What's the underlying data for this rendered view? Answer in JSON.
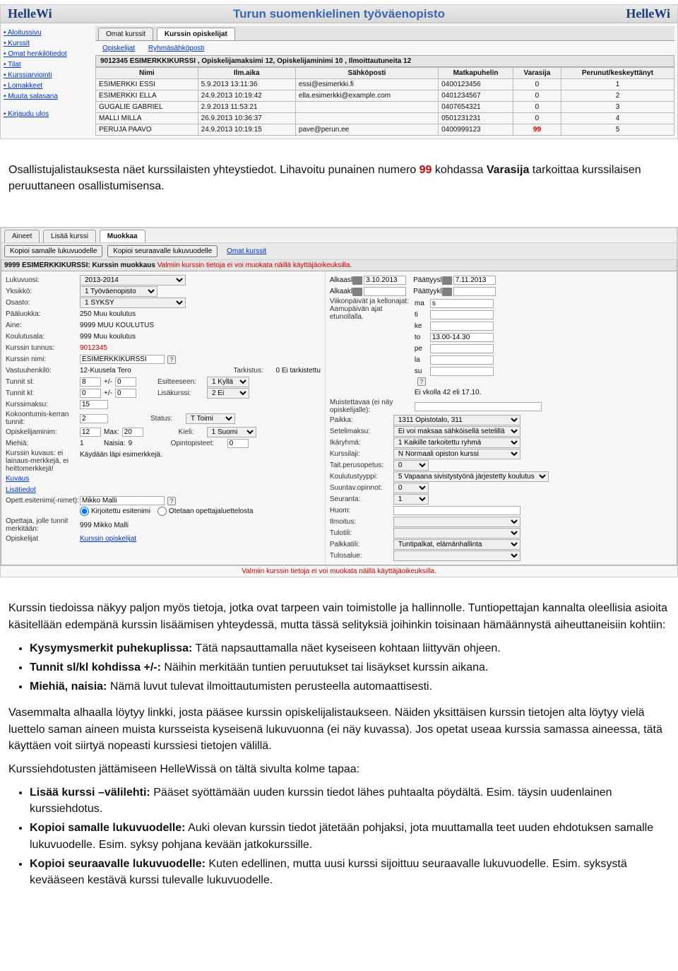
{
  "ss1": {
    "logoLeft": "HelleWi",
    "logoRight": "HelleWi",
    "title": "Turun suomenkielinen työväenopisto",
    "nav": [
      "Aloitussivu",
      "Kurssit",
      "Omat henkilötiedot",
      "Tilat",
      "Kurssiarviointi",
      "Lomakkeet",
      "Muuta salasana"
    ],
    "logout": "Kirjaudu ulos",
    "tabsTop": {
      "t1": "Omat kurssit",
      "t2": "Kurssin opiskelijat"
    },
    "subtabs": {
      "a": "Opiskelijat",
      "b": "Ryhmäsähköposti"
    },
    "tableTitle": "9012345 ESIMERKKIKURSSI , Opiskelijamaksimi 12, Opiskelijaminimi 10 , Ilmoittautuneita 12",
    "cols": [
      "Nimi",
      "Ilm.aika",
      "Sähköposti",
      "Matkapuhelin",
      "Varasija",
      "Perunut/keskeyttänyt"
    ],
    "rows": [
      {
        "n": "ESIMERKKI ESSI",
        "a": "5.9.2013 13:11:36",
        "e": "essi@esimerkki.fi",
        "m": "0400123456",
        "v": "0",
        "p": "1"
      },
      {
        "n": "ESIMERKKI ELLA",
        "a": "24.9.2013 10:19:42",
        "e": "ella.esimerkki@example.com",
        "m": "0401234567",
        "v": "0",
        "p": "2"
      },
      {
        "n": "GUGALIE GABRIEL",
        "a": "2.9.2013 11:53:21",
        "e": "",
        "m": "0407654321",
        "v": "0",
        "p": "3"
      },
      {
        "n": "MALLI MILLA",
        "a": "26.9.2013 10:36:37",
        "e": "",
        "m": "0501231231",
        "v": "0",
        "p": "4"
      },
      {
        "n": "PERUJA PAAVO",
        "a": "24.9.2013 10:19:15",
        "e": "pave@perun.ee",
        "m": "0400999123",
        "v": "99",
        "p": "5"
      }
    ]
  },
  "ss2": {
    "tabs": {
      "a": "Aineet",
      "b": "Lisää kurssi",
      "c": "Muokkaa"
    },
    "buttons": {
      "k1": "Kopioi samalle lukuvuodelle",
      "k2": "Kopioi seuraavalle lukuvuodelle",
      "k3": "Omat kurssit"
    },
    "title": "9999 ESIMERKKIKURSSI: Kurssin muokkaus",
    "titleWarn": "Valmiin kurssin tietoja ei voi muokata näillä käyttäjäoikeuksilla.",
    "left": {
      "lukuvuosi_l": "Lukuvuosi:",
      "lukuvuosi_v": "2013-2014",
      "osasto_l": "Osasto:",
      "osasto_v": "1 SYKSY",
      "paaluokka_l": "Pääluokka:",
      "paaluokka_v": "250 Muu koulutus",
      "aine_l": "Aine:",
      "aine_v": "9999 MUU KOULUTUS",
      "koulutusala_l": "Koulutusala:",
      "koulutusala_v": "999 Muu koulutus",
      "tunnus_l": "Kurssin tunnus:",
      "tunnus_v": "9012345",
      "nimi_l": "Kurssin nimi:",
      "nimi_v": "ESIMERKKIKURSSI",
      "vastuu_l": "Vastuuhenkilö:",
      "vastuu_v": "12-Kuusela Tero",
      "tunnitsl_l": "Tunnit sl:",
      "tunnitsl_v": "8",
      "tunnitsl_pm": "+/-",
      "tunnitsl_v2": "0",
      "tarkistus_l": "Tarkistus:",
      "tarkistus_v": "0 Ei tarkistettu",
      "tunnitkl_l": "Tunnit kl:",
      "tunnitkl_v": "0",
      "tunnitkl_pm": "+/-",
      "tunnitkl_v2": "0",
      "esitteeseen_l": "Esitteeseen:",
      "esitteeseen_v": "1 Kyllä",
      "lisakurssi_l": "Lisäkurssi:",
      "lisakurssi_v": "2 Ei",
      "maksu_l": "Kurssimaksu:",
      "maksu_v": "15",
      "kokoont_l": "Kokoontumis-kerran tunnit:",
      "kokoont_v": "2",
      "status_l": "Status:",
      "status_v": "T Toimi",
      "opiskmin_l": "Opiskelijaminim:",
      "opiskmin_v": "12",
      "max_l": "Max:",
      "max_v": "20",
      "kieli_l": "Kieli:",
      "kieli_v": "1 Suomi",
      "miehia_l": "Miehiä:",
      "miehia_v": "1",
      "naisia_l": "Naisia:",
      "naisia_v": "9",
      "opinto_l": "Opintopisteet:",
      "opinto_v": "0",
      "kuvaus_l": "Kurssin kuvaus: ei lainaus-merkkejä, ei heittomerkkejä!",
      "kuvaus_link": "Kuvaus",
      "kuvaus_v": "Käydään läpi esimerkkejä.",
      "lisat_l": "Lisätiedot",
      "opetnimi_l": "Opett.esitenimi(-nimet):",
      "opetnimi_v": "Mikko Malli",
      "radio1": "Kirjoitettu esitenimi",
      "radio2": "Otetaan opettajaluettelosta",
      "merk_l": "Opettaja, jolle tunnit merkitään:",
      "merk_v": "999 Mikko Malli",
      "opisk_l": "Opiskelijat",
      "opisk_link": "Kurssin opiskelijat"
    },
    "right": {
      "yksikko_l": "Yksikkö:",
      "yksikko_v": "1 Työväenopisto",
      "alkaasl_l": "Alkaasl",
      "alkaasl_v": "3.10.2013",
      "paattyysl_l": "Päättyysl",
      "paattyysl_v": "7.11.2013",
      "alkaakl_l": "Alkaakl",
      "paattyykl_l": "Päättyykl",
      "vkp_l": "Viikonpäivät ja kellonajat: Aamupäivän ajat etunollalla.",
      "days": [
        {
          "d": "ma",
          "t": "s"
        },
        {
          "d": "ti",
          "t": ""
        },
        {
          "d": "ke",
          "t": ""
        },
        {
          "d": "to",
          "t": "13.00-14.30"
        },
        {
          "d": "pe",
          "t": ""
        },
        {
          "d": "la",
          "t": ""
        },
        {
          "d": "su",
          "t": ""
        }
      ],
      "eivko": "Ei vkolla 42 eli 17.10.",
      "muistettavaa_l": "Muistettavaa (ei näy opiskelijalle):",
      "paikka_l": "Paikka:",
      "paikka_v": "1311 Opistotalo, 311",
      "setelimaksu_l": "Setelimaksu:",
      "setelimaksu_v": "Ei voi maksaa sähköisellä setelillä",
      "ikaryhma_l": "Ikäryhmä:",
      "ikaryhma_v": "1 Kaikille tarkoitettu ryhmä",
      "kurssilaji_l": "Kurssilaji:",
      "kurssilaji_v": "N Normaali opiston kurssi",
      "taitper_l": "Tait.perusopetus:",
      "taitper_v": "0",
      "koultype_l": "Koulutustyyppi:",
      "koultype_v": "5 Vapaana sivistystyönä järjestetty koulutus",
      "suuntav_l": "Suuntav.opinnot:",
      "suuntav_v": "0",
      "seuranta_l": "Seuranta:",
      "seuranta_v": "1",
      "huom_l": "Huom:",
      "ilmoitus_l": "Ilmoitus:",
      "tulotili_l": "Tulotili:",
      "palkkatili_l": "Palkkatili:",
      "palkkatili_v": "Tuntipalkat, elämänhallinta",
      "tulosalue_l": "Tulosalue:"
    },
    "footer": "Valmiin kurssin tietoja ei voi muokata näillä käyttäjäoikeuksilla."
  },
  "doc": {
    "p1a": "Osallistujalistauksesta näet kurssilaisten yhteystiedot. Lihavoitu punainen numero ",
    "p1num": "99",
    "p1b": " kohdassa ",
    "p1bold": "Varasija",
    "p1c": " tarkoittaa kurssilaisen peruuttaneen osallistumisensa.",
    "p2": "Kurssin tiedoissa näkyy paljon myös tietoja, jotka ovat tarpeen vain toimistolle ja hallinnolle. Tuntiopettajan kannalta oleellisia asioita käsitellään edempänä kurssin lisäämisen yhteydessä, mutta tässä selityksiä joihinkin toisinaan hämäännystä aiheuttaneisiin kohtiin:",
    "b1a": "Kysymysmerkit puhekuplissa:",
    "b1b": "Tätä napsauttamalla näet kyseiseen kohtaan liittyvän ohjeen.",
    "b2a": "Tunnit sl/kl kohdissa +/-:",
    "b2b": "Näihin merkitään tuntien peruutukset tai lisäykset kurssin aikana.",
    "b3a": "Miehiä, naisia:",
    "b3b": "Nämä luvut tulevat ilmoittautumisten perusteella automaattisesti.",
    "p3": "Vasemmalta alhaalla löytyy linkki, josta pääsee kurssin opiskelijalistaukseen. Näiden yksittäisen kurssin tietojen alta löytyy vielä luettelo saman aineen muista kursseista kyseisenä lukuvuonna (ei näy kuvassa). Jos opetat useaa kurssia samassa aineessa, tätä käyttäen voit siirtyä nopeasti kurssiesi tietojen välillä.",
    "p4": "Kurssiehdotusten jättämiseen HelleWissä on tältä sivulta kolme tapaa:",
    "c1a": "Lisää kurssi –välilehti:",
    "c1b": "Pääset syöttämään uuden kurssin tiedot lähes puhtaalta pöydältä. Esim. täysin uudenlainen kurssiehdotus.",
    "c2a": "Kopioi samalle lukuvuodelle:",
    "c2b": "Auki olevan kurssin tiedot jätetään pohjaksi, jota muuttamalla teet uuden ehdotuksen samalle lukuvuodelle. Esim. syksy pohjana kevään jatkokurssille.",
    "c3a": "Kopioi seuraavalle lukuvuodelle:",
    "c3b": "Kuten edellinen, mutta uusi kurssi sijoittuu seuraavalle lukuvuodelle. Esim. syksystä kevääseen kestävä kurssi tulevalle lukuvuodelle."
  }
}
